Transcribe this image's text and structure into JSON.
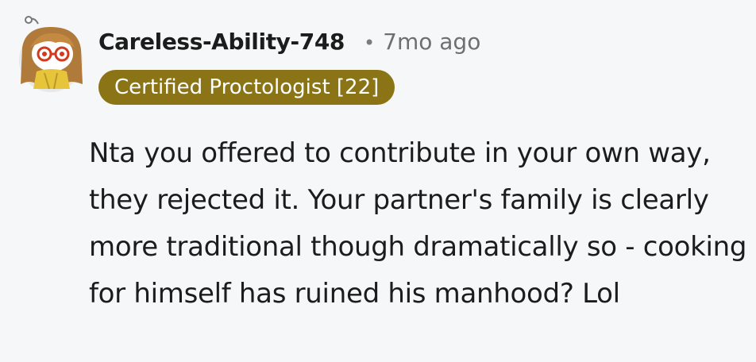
{
  "comment": {
    "username": "Careless-Ability-748",
    "separator": "•",
    "timestamp": "7mo ago",
    "flair": "Certified Proctologist [22]",
    "body": "Nta you offered to contribute in your own way, they rejected it. Your partner's family is clearly more traditional though dramatically so - cooking for himself has ruined his manhood? Lol"
  },
  "colors": {
    "background": "#f6f7f8",
    "flair_background": "#8a7415",
    "flair_text": "#ffffff",
    "text": "#1c1c1c",
    "muted": "#6f6f6f"
  },
  "icons": {
    "avatar": "snoo-avatar-icon"
  }
}
